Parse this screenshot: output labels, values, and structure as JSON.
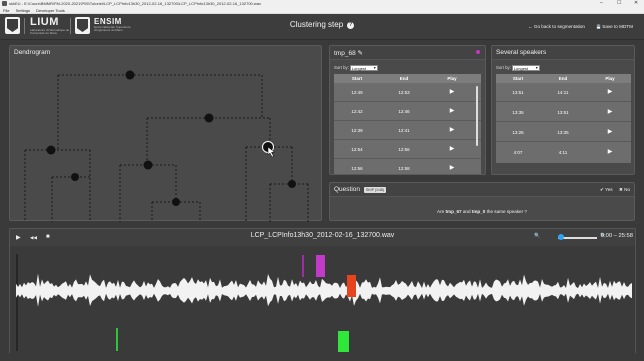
{
  "window": {
    "title": "skkEU - E:\\Cours\\BMMR\\FM-2020-2021\\P05\\Tutoriel\\LCP_LCPInfo13h30_2012-02-16_132700\\LCP_LCPInfo13h30_2012-02-16_132700.wav",
    "min_glyph": "–",
    "max_glyph": "☐",
    "close_glyph": "✕"
  },
  "menu": [
    "File",
    "Settings",
    "Developer Tools"
  ],
  "header": {
    "logo1_text": "LIUM",
    "logo1_sub": "Laboratoire d'Informatique de l'Université du Mans",
    "logo2_text": "ENSIM",
    "logo2_sub": "École Nationale Supérieure d'Ingénieurs du Mans",
    "step_title": "Clustering step",
    "help_glyph": "?",
    "back_button": "Go back to segmentation",
    "save_button": "Save to MDTM",
    "back_glyph": "←",
    "save_glyph": "💾"
  },
  "dendrogram": {
    "title": "Dendrogram",
    "leaf_colors": [
      "#ffffff",
      "#8ed88e",
      "#b35a14",
      "#b542a8",
      "#3fbf8c",
      "#3fbf8c",
      "#3fbf8c",
      "#3fbf8c",
      "#c13ac8",
      "#4ccc4c",
      "#2fc43a",
      "#e6431f"
    ]
  },
  "speaker_panel": {
    "title": "tmp_68",
    "edit_icon": "✎",
    "sort_label": "Sort by:",
    "sort_value": "Longest",
    "columns": [
      "Start",
      "End",
      "Play"
    ],
    "rows": [
      {
        "start": "12:49",
        "end": "12:53"
      },
      {
        "start": "12:42",
        "end": "12:46"
      },
      {
        "start": "12:39",
        "end": "12:41"
      },
      {
        "start": "12:54",
        "end": "12:56"
      },
      {
        "start": "12:56",
        "end": "12:58"
      }
    ],
    "play_glyph": "▶",
    "accent": "#c13ac8"
  },
  "several_panel": {
    "title": "Several speakers",
    "sort_label": "Sort by:",
    "sort_value": "Longest",
    "columns": [
      "Start",
      "End",
      "Play"
    ],
    "rows": [
      {
        "start": "13:51",
        "end": "14:11"
      },
      {
        "start": "13:35",
        "end": "13:51"
      },
      {
        "start": "13:26",
        "end": "13:35"
      },
      {
        "start": "4:07",
        "end": "4:11"
      }
    ],
    "play_glyph": "▶"
  },
  "question": {
    "title": "Question",
    "badge": "SKIP (1/48)",
    "prefix": "Are",
    "speaker_a": "tmp_67",
    "middle": "and",
    "speaker_b": "tmp_0",
    "suffix": "the same speaker ?",
    "yes": "Yes",
    "no": "No",
    "yes_glyph": "✔",
    "no_glyph": "✖"
  },
  "player": {
    "filename": "LCP_LCPInfo13h30_2012-02-16_132700.wav",
    "play_glyph": "▶",
    "skip_glyph": "◀◀",
    "stop_glyph": "■",
    "zoom_out_glyph": "🔍",
    "zoom_in_glyph": "🔍",
    "time": "0:00 – 25:58",
    "zoom_level": 0.0
  }
}
